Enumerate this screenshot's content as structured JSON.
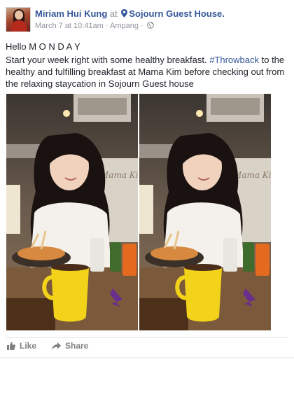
{
  "post": {
    "author": "Miriam Hui Kung",
    "at_word": "at",
    "location": "Sojourn Guest House.",
    "date": "March 7 at 10:41am",
    "separator": "·",
    "place_tag": "Ampang",
    "text_line1": "Hello M O N D A Y",
    "text_part1": "Start your week right with some healthy breakfast. ",
    "hashtag": "#Throwback",
    "text_part2": " to the healthy and fulfilling breakfast at Mama Kim before checking out from the relaxing staycation in Sojourn Guest house",
    "photo_sign": "Mama Kim"
  },
  "actions": {
    "like_label": "Like",
    "share_label": "Share"
  },
  "icons": {
    "location": "map-pin-icon",
    "privacy": "globe-icon",
    "like": "thumbs-up-icon",
    "share": "share-arrow-icon"
  },
  "colors": {
    "link": "#365899",
    "meta": "#90949c",
    "action": "#7f7f7f"
  }
}
